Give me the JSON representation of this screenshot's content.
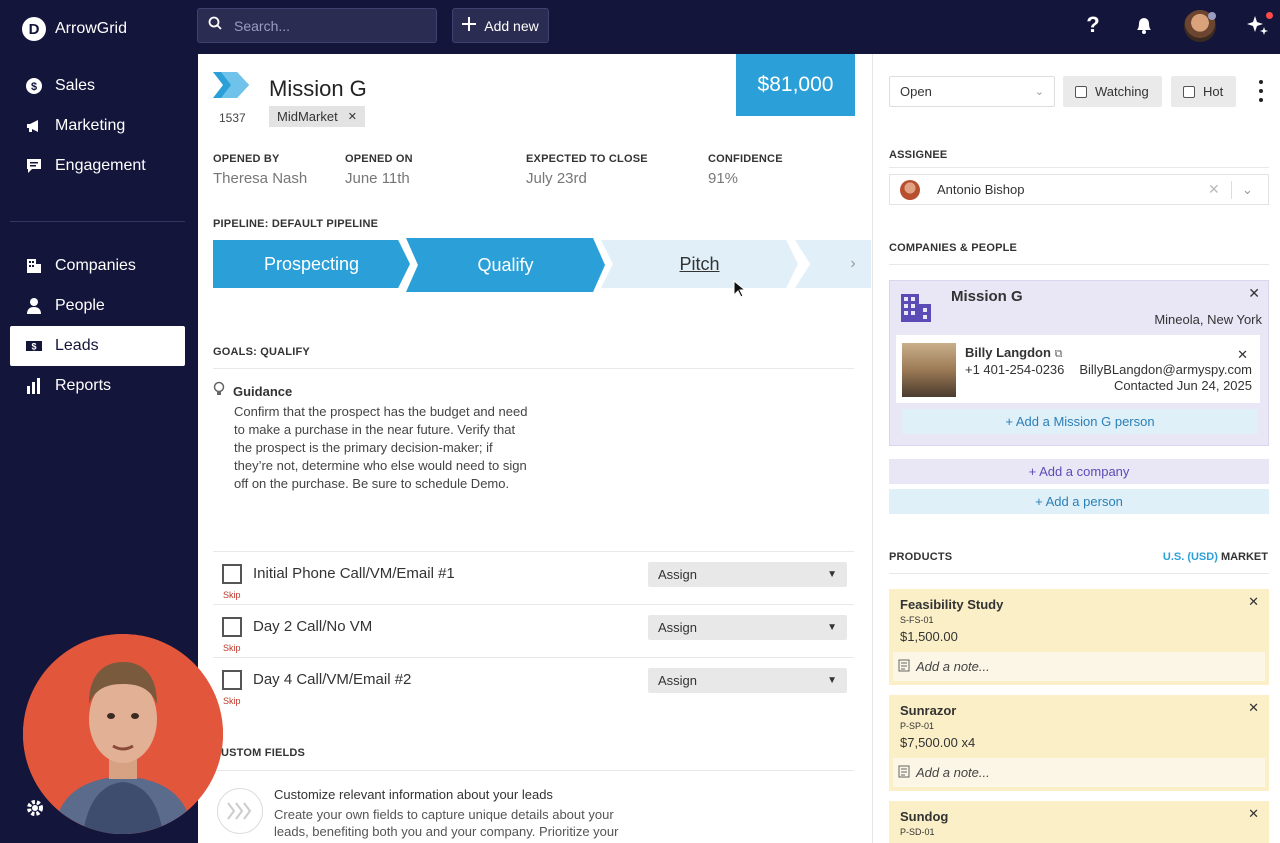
{
  "app": {
    "name": "ArrowGrid"
  },
  "sidebar": {
    "items": [
      {
        "label": "Sales",
        "icon": "dollar-circle-icon"
      },
      {
        "label": "Marketing",
        "icon": "megaphone-icon"
      },
      {
        "label": "Engagement",
        "icon": "chat-icon"
      },
      {
        "label": "Companies",
        "icon": "building-icon"
      },
      {
        "label": "People",
        "icon": "person-icon"
      },
      {
        "label": "Leads",
        "icon": "leads-icon",
        "active": true
      },
      {
        "label": "Reports",
        "icon": "bar-chart-icon"
      }
    ]
  },
  "topbar": {
    "search_placeholder": "Search...",
    "add_new_label": "Add new"
  },
  "lead": {
    "id": "1537",
    "title": "Mission G",
    "tag": "MidMarket",
    "amount": "$81,000",
    "meta": [
      {
        "label": "OPENED BY",
        "value": "Theresa Nash"
      },
      {
        "label": "OPENED ON",
        "value": "June 11th"
      },
      {
        "label": "EXPECTED TO CLOSE",
        "value": "July 23rd"
      },
      {
        "label": "CONFIDENCE",
        "value": "91%"
      }
    ],
    "pipeline_label": "PIPELINE: DEFAULT PIPELINE",
    "stages": [
      {
        "label": "Prospecting",
        "state": "done"
      },
      {
        "label": "Qualify",
        "state": "active"
      },
      {
        "label": "Pitch",
        "state": "next"
      }
    ],
    "goals_label": "GOALS: QUALIFY",
    "guidance_title": "Guidance",
    "guidance_text": "Confirm that the prospect has the budget and need to make a purchase in the near future. Verify that the prospect is the primary decision-maker; if they’re not, determine who else would need to sign off on the purchase. Be sure to schedule Demo.",
    "tasks": [
      {
        "name": "Initial Phone Call/VM/Email #1",
        "skip": "Skip",
        "assign": "Assign"
      },
      {
        "name": "Day 2 Call/No VM",
        "skip": "Skip",
        "assign": "Assign"
      },
      {
        "name": "Day 4 Call/VM/Email #2",
        "skip": "Skip",
        "assign": "Assign"
      }
    ],
    "custom_fields_label": "USTOM FIELDS",
    "custom_title": "Customize relevant information about your leads",
    "custom_text": "Create your own fields to capture unique details about your leads, benefiting both you and your company. Prioritize your"
  },
  "right": {
    "status": "Open",
    "watching_label": "Watching",
    "hot_label": "Hot",
    "assignee_label": "ASSIGNEE",
    "assignee_name": "Antonio Bishop",
    "companies_label": "COMPANIES & PEOPLE",
    "company": {
      "name": "Mission G",
      "location": "Mineola, New York",
      "person": {
        "name": "Billy Langdon",
        "phone": "+1 401-254-0236",
        "email": "BillyBLangdon@armyspy.com",
        "contacted": "Contacted Jun 24, 2025"
      },
      "add_person_label": "+ Add a Mission G person"
    },
    "add_company_label": "+ Add a company",
    "add_person_label": "+ Add a person",
    "products_label": "PRODUCTS",
    "currency_blue": "U.S. (USD)",
    "currency_rest": "MARKET",
    "note_placeholder": "Add a note...",
    "products": [
      {
        "name": "Feasibility Study",
        "sku": "S-FS-01",
        "price": "$1,500.00"
      },
      {
        "name": "Sunrazor",
        "sku": "P-SP-01",
        "price": "$7,500.00 x4"
      },
      {
        "name": "Sundog",
        "sku": "P-SD-01",
        "price": ""
      }
    ]
  },
  "colors": {
    "sidebar_bg": "#14153a",
    "accent_blue": "#2ba0d8",
    "company_card_bg": "#e9e7f6",
    "product_bg": "#fbefc7"
  }
}
